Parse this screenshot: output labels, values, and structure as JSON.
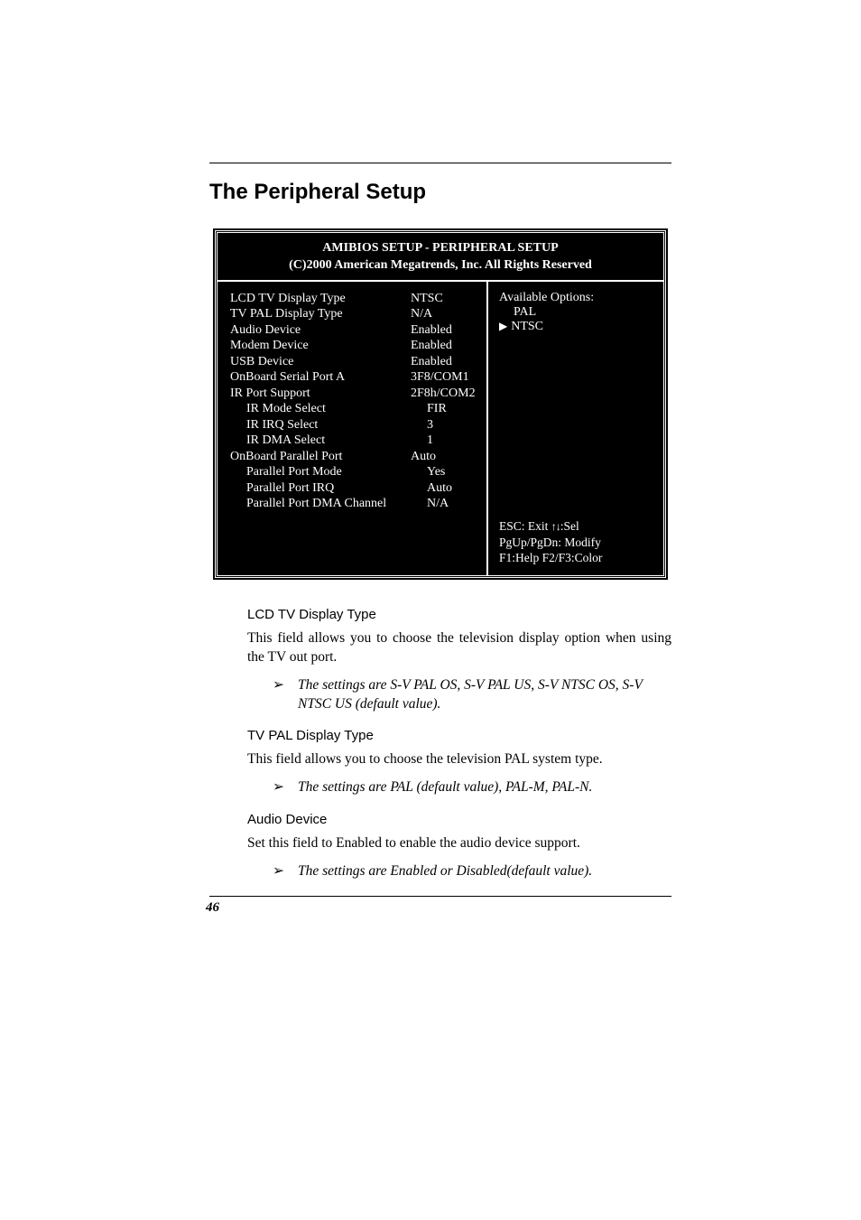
{
  "section_title": "The Peripheral Setup",
  "bios": {
    "header_line1": "AMIBIOS SETUP - PERIPHERAL SETUP",
    "header_line2": "(C)2000 American Megatrends, Inc. All Rights Reserved",
    "rows": [
      {
        "label": "LCD TV Display Type",
        "value": "NTSC",
        "indent": 0
      },
      {
        "label": "TV PAL Display Type",
        "value": "N/A",
        "indent": 0
      },
      {
        "label": "Audio Device",
        "value": "Enabled",
        "indent": 0
      },
      {
        "label": "Modem Device",
        "value": "Enabled",
        "indent": 0
      },
      {
        "label": "USB Device",
        "value": "Enabled",
        "indent": 0
      },
      {
        "label": "OnBoard Serial Port A",
        "value": "3F8/COM1",
        "indent": 0
      },
      {
        "label": "IR Port Support",
        "value": "2F8h/COM2",
        "indent": 0
      },
      {
        "label": "IR Mode Select",
        "value": "FIR",
        "indent": 1
      },
      {
        "label": "IR IRQ Select",
        "value": "3",
        "indent": 1
      },
      {
        "label": "IR DMA Select",
        "value": "1",
        "indent": 1
      },
      {
        "label": "OnBoard Parallel Port",
        "value": "Auto",
        "indent": 0
      },
      {
        "label": "Parallel Port Mode",
        "value": "Yes",
        "indent": 1
      },
      {
        "label": "Parallel Port IRQ",
        "value": "Auto",
        "indent": 1
      },
      {
        "label": "Parallel Port DMA Channel",
        "value": "N/A",
        "indent": 1
      }
    ],
    "options_header": "Available Options:",
    "option_pal": "PAL",
    "option_ntsc": "NTSC",
    "help1a": "ESC: Exit ",
    "help1b": ":Sel",
    "help2": "PgUp/PgDn: Modify",
    "help3": "F1:Help  F2/F3:Color"
  },
  "doc": {
    "h1": "LCD TV Display Type",
    "p1": "This field allows you to choose the television display option when using the TV out port.",
    "b1": "The settings are S-V PAL OS, S-V PAL US, S-V NTSC OS, S-V NTSC US (default value).",
    "h2": "TV PAL Display Type",
    "p2": "This field allows you to choose the television PAL system type.",
    "b2": "The settings are PAL (default value), PAL-M, PAL-N.",
    "h3": "Audio Device",
    "p3": "Set this field to Enabled to enable the audio device support.",
    "b3": "The settings are Enabled or Disabled(default value)."
  },
  "page_number": "46"
}
